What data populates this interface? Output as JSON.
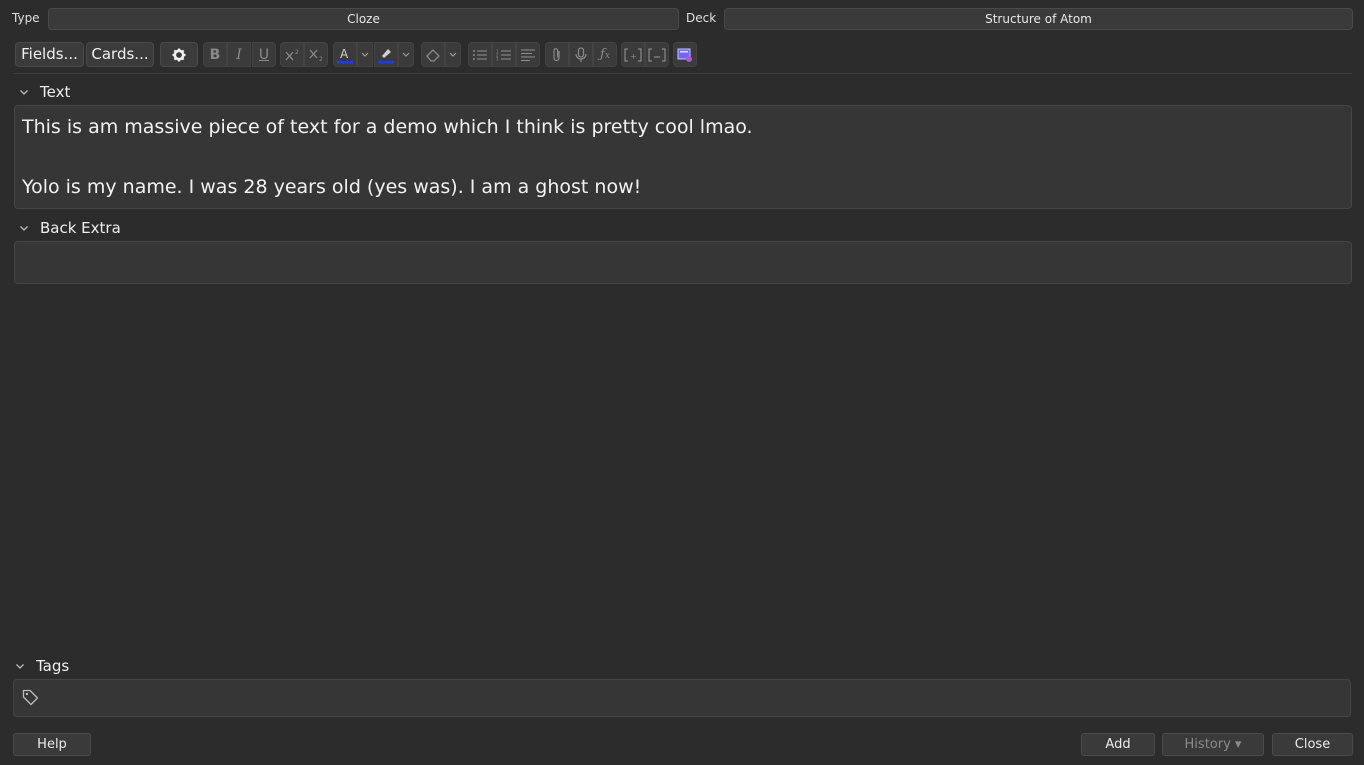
{
  "top": {
    "type_label": "Type",
    "type_value": "Cloze",
    "deck_label": "Deck",
    "deck_value": "Structure of Atom"
  },
  "toolbar": {
    "fields_button": "Fields...",
    "cards_button": "Cards...",
    "icons": [
      "gear-icon",
      "bold-icon",
      "italic-icon",
      "underline-icon",
      "superscript-icon",
      "subscript-icon",
      "text-color-icon",
      "highlight-icon",
      "eraser-icon",
      "bullet-list-icon",
      "numbered-list-icon",
      "align-icon",
      "attach-icon",
      "microphone-icon",
      "math-fx-icon",
      "cloze-icon",
      "cloze-same-icon",
      "html-editor-icon"
    ],
    "font_color": "#1a3cff",
    "highlight_color": "#1a3cff",
    "accent": "#6f66ff"
  },
  "fields": [
    {
      "name": "Text",
      "lines": [
        "This is am massive piece of text for a demo which I think is pretty cool lmao.",
        "",
        "Yolo is my name. I was 28 years old (yes was). I am a ghost now!"
      ]
    },
    {
      "name": "Back Extra",
      "lines": []
    }
  ],
  "tags": {
    "label": "Tags"
  },
  "bottom": {
    "help": "Help",
    "add": "Add",
    "history": "History ▾",
    "close": "Close"
  }
}
